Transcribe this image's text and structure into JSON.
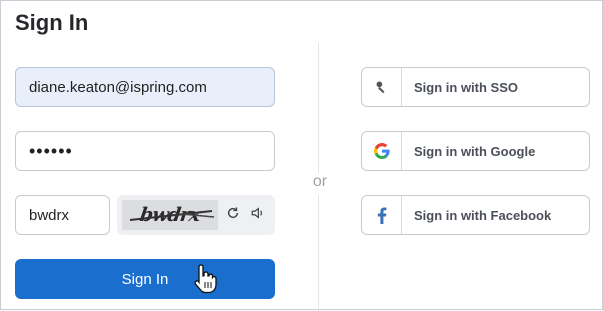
{
  "title": "Sign In",
  "form": {
    "email_value": "diane.keaton@ispring.com",
    "password_value": "••••••",
    "captcha_value": "bwdrx",
    "captcha_image_text": "bwdrx",
    "submit_label": "Sign In"
  },
  "divider": {
    "label": "or"
  },
  "social": [
    {
      "label": "Sign in with SSO",
      "icon": "key-icon"
    },
    {
      "label": "Sign in with Google",
      "icon": "google-icon"
    },
    {
      "label": "Sign in with Facebook",
      "icon": "facebook-icon"
    }
  ],
  "colors": {
    "primary": "#1a6fce",
    "email_fill": "#e8effb",
    "facebook": "#3b72b7"
  }
}
